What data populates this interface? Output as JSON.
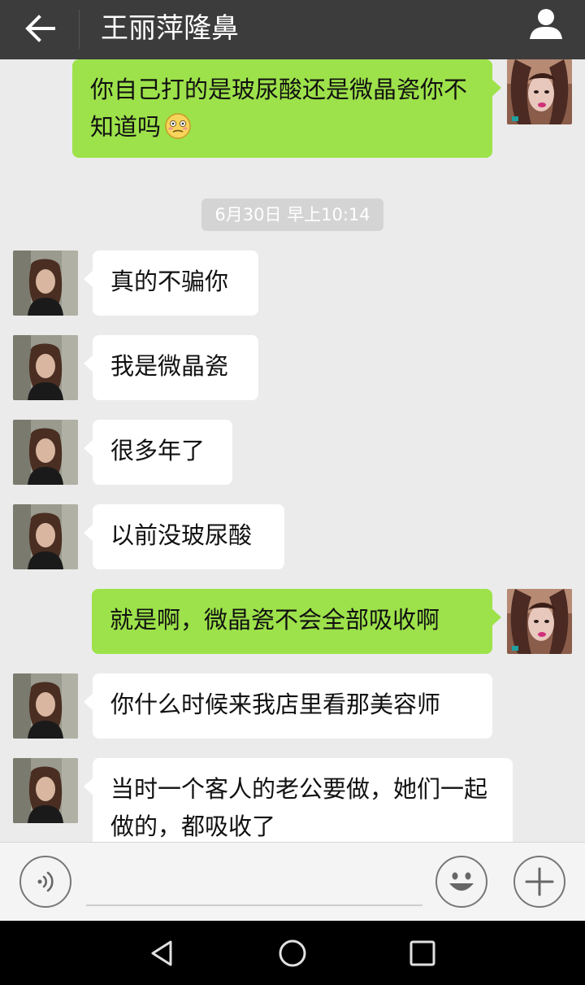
{
  "header": {
    "title": "王丽萍隆鼻"
  },
  "messages": [
    {
      "sender": "me",
      "text": "你自己打的是玻尿酸还是微晶瓷你不知道吗",
      "emoji": "embarrassed-face-emoji"
    },
    {
      "sender": "other",
      "text": "真的不骗你"
    },
    {
      "sender": "other",
      "text": "我是微晶瓷"
    },
    {
      "sender": "other",
      "text": "很多年了"
    },
    {
      "sender": "other",
      "text": "以前没玻尿酸"
    },
    {
      "sender": "me",
      "text": "就是啊，微晶瓷不会全部吸收啊"
    },
    {
      "sender": "other",
      "text": "你什么时候来我店里看那美容师"
    },
    {
      "sender": "other",
      "text": "当时一个客人的老公要做，她们一起做的，都吸收了"
    }
  ],
  "timestamp": "6月30日 早上10:14",
  "input": {
    "value": "",
    "placeholder": ""
  },
  "colors": {
    "header_bg": "#3c3c3c",
    "chat_bg": "#ebebeb",
    "my_bubble": "#9de24a",
    "other_bubble": "#ffffff",
    "timestamp_bg": "#d4d4d4"
  },
  "icons": {
    "back": "arrow-left-icon",
    "contact": "person-icon",
    "voice": "voice-icon",
    "emoji": "smiley-icon",
    "more": "plus-icon",
    "nav_back": "triangle-back-icon",
    "nav_home": "circle-home-icon",
    "nav_recent": "square-recent-icon"
  }
}
